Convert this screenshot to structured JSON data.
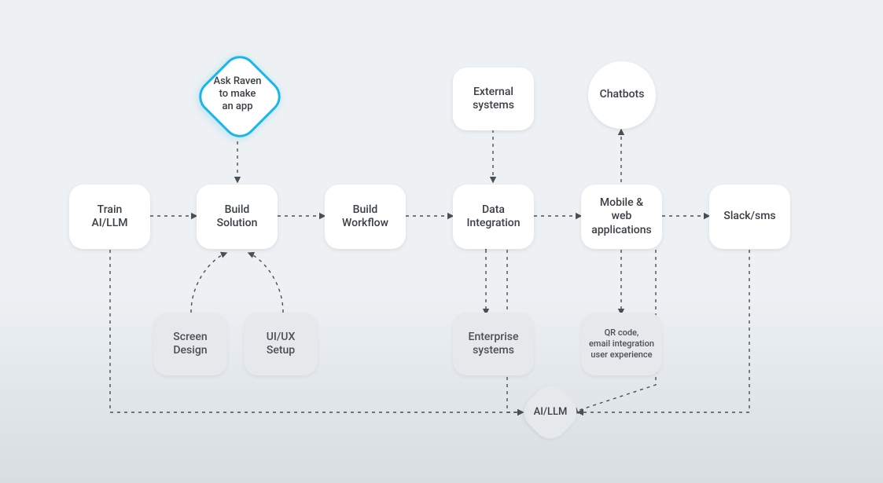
{
  "nodes": {
    "ask_raven": "Ask Raven\nto make\nan app",
    "train_ai": "Train\nAI/LLM",
    "build_solution": "Build\nSolution",
    "build_workflow": "Build\nWorkflow",
    "data_integration": "Data\nIntegration",
    "mobile_web": "Mobile &\nweb\napplications",
    "slack_sms": "Slack/sms",
    "external_systems": "External\nsystems",
    "chatbots": "Chatbots",
    "screen_design": "Screen\nDesign",
    "uiux_setup": "UI/UX\nSetup",
    "enterprise_systems": "Enterprise\nsystems",
    "qr_email": "QR code,\nemail integration\nuser experience",
    "ai_llm": "AI/LLM"
  }
}
